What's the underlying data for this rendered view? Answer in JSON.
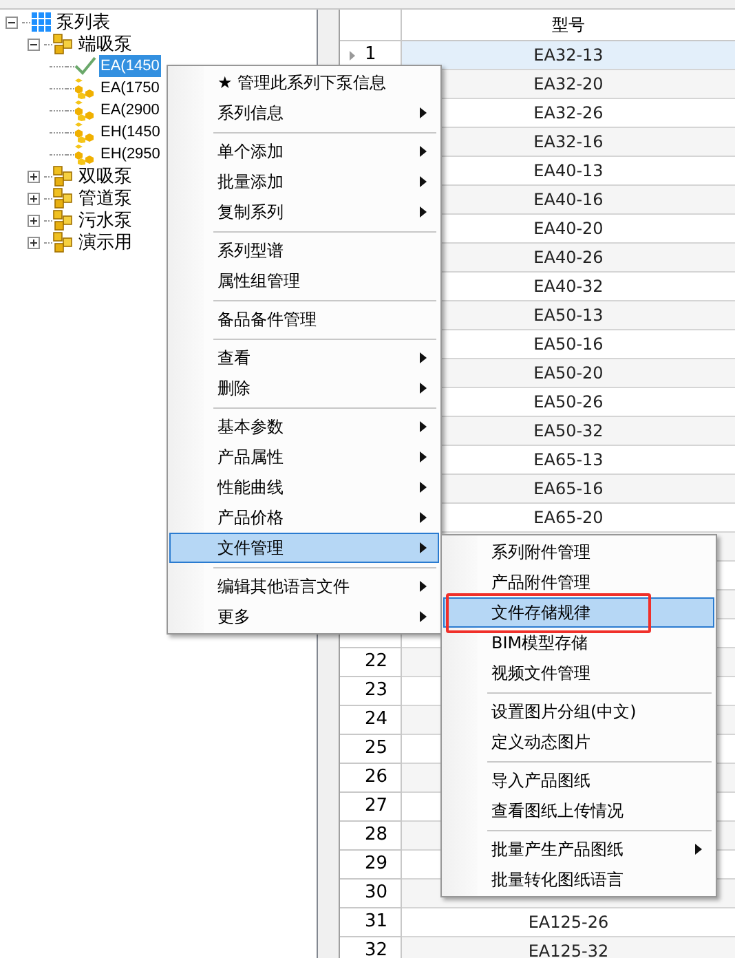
{
  "tree": {
    "label": "泵列表",
    "expanded": true,
    "children": [
      {
        "label": "端吸泵",
        "expanded": true,
        "children": [
          {
            "label": "EA(1450",
            "selected": true
          },
          {
            "label": "EA(1750",
            "selected": false
          },
          {
            "label": "EA(2900",
            "selected": false
          },
          {
            "label": "EH(1450",
            "selected": false
          },
          {
            "label": "EH(2950",
            "selected": false
          }
        ]
      },
      {
        "label": "双吸泵",
        "expanded": false
      },
      {
        "label": "管道泵",
        "expanded": false
      },
      {
        "label": "污水泵",
        "expanded": false
      },
      {
        "label": "演示用",
        "expanded": false
      }
    ]
  },
  "table": {
    "columns": [
      "型号"
    ],
    "rows": [
      {
        "number": "1",
        "model": "EA32-13",
        "selected": true
      },
      {
        "model": "EA32-20",
        "selected": false
      },
      {
        "model": "EA32-26",
        "selected": false
      },
      {
        "model": "EA32-16",
        "selected": false
      },
      {
        "model": "EA40-13",
        "selected": false
      },
      {
        "model": "EA40-16",
        "selected": false
      },
      {
        "model": "EA40-20",
        "selected": false
      },
      {
        "model": "EA40-26",
        "selected": false
      },
      {
        "model": "EA40-32",
        "selected": false
      },
      {
        "model": "EA50-13",
        "selected": false
      },
      {
        "model": "EA50-16",
        "selected": false
      },
      {
        "model": "EA50-20",
        "selected": false
      },
      {
        "model": "EA50-26",
        "selected": false
      },
      {
        "model": "EA50-32",
        "selected": false
      },
      {
        "model": "EA65-13",
        "selected": false
      },
      {
        "model": "EA65-16",
        "selected": false
      },
      {
        "model": "EA65-20",
        "selected": false
      },
      {
        "selected": false
      },
      {
        "selected": false
      },
      {
        "selected": false
      },
      {
        "selected": false
      },
      {
        "number": "22",
        "selected": false
      },
      {
        "number": "23",
        "selected": false
      },
      {
        "number": "24",
        "selected": false
      },
      {
        "number": "25",
        "selected": false
      },
      {
        "number": "26",
        "selected": false
      },
      {
        "number": "27",
        "selected": false
      },
      {
        "number": "28",
        "selected": false
      },
      {
        "number": "29",
        "selected": false
      },
      {
        "number": "30",
        "selected": false
      },
      {
        "number": "31",
        "model": "EA125-26",
        "selected": false
      },
      {
        "number": "32",
        "model": "EA125-32",
        "selected": false
      }
    ]
  },
  "context_menu": [
    {
      "kind": "item",
      "label": "★ 管理此系列下泵信息",
      "submenu": false,
      "selected": false
    },
    {
      "kind": "item",
      "label": "系列信息",
      "submenu": true,
      "selected": false
    },
    {
      "kind": "separator"
    },
    {
      "kind": "item",
      "label": "单个添加",
      "submenu": true,
      "selected": false
    },
    {
      "kind": "item",
      "label": "批量添加",
      "submenu": true,
      "selected": false
    },
    {
      "kind": "item",
      "label": "复制系列",
      "submenu": true,
      "selected": false
    },
    {
      "kind": "separator"
    },
    {
      "kind": "item",
      "label": "系列型谱",
      "submenu": false,
      "selected": false
    },
    {
      "kind": "item",
      "label": "属性组管理",
      "submenu": false,
      "selected": false
    },
    {
      "kind": "separator"
    },
    {
      "kind": "item",
      "label": "备品备件管理",
      "submenu": false,
      "selected": false
    },
    {
      "kind": "separator"
    },
    {
      "kind": "item",
      "label": "查看",
      "submenu": true,
      "selected": false
    },
    {
      "kind": "item",
      "label": "删除",
      "submenu": true,
      "selected": false
    },
    {
      "kind": "separator"
    },
    {
      "kind": "item",
      "label": "基本参数",
      "submenu": true,
      "selected": false
    },
    {
      "kind": "item",
      "label": "产品属性",
      "submenu": true,
      "selected": false
    },
    {
      "kind": "item",
      "label": "性能曲线",
      "submenu": true,
      "selected": false
    },
    {
      "kind": "item",
      "label": "产品价格",
      "submenu": true,
      "selected": false
    },
    {
      "kind": "item",
      "label": "文件管理",
      "submenu": true,
      "selected": true
    },
    {
      "kind": "separator"
    },
    {
      "kind": "item",
      "label": "编辑其他语言文件",
      "submenu": true,
      "selected": false
    },
    {
      "kind": "item",
      "label": "更多",
      "submenu": true,
      "selected": false
    }
  ],
  "submenu": [
    {
      "kind": "item",
      "label": "系列附件管理",
      "submenu": false,
      "selected": false
    },
    {
      "kind": "item",
      "label": "产品附件管理",
      "submenu": false,
      "selected": false
    },
    {
      "kind": "item",
      "label": "文件存储规律",
      "submenu": false,
      "selected": true,
      "marked": true
    },
    {
      "kind": "item",
      "label": "BIM模型存储",
      "submenu": false,
      "selected": false
    },
    {
      "kind": "item",
      "label": "视频文件管理",
      "submenu": false,
      "selected": false
    },
    {
      "kind": "separator"
    },
    {
      "kind": "item",
      "label": "设置图片分组(中文)",
      "submenu": false,
      "selected": false
    },
    {
      "kind": "item",
      "label": "定义动态图片",
      "submenu": false,
      "selected": false
    },
    {
      "kind": "separator"
    },
    {
      "kind": "item",
      "label": "导入产品图纸",
      "submenu": false,
      "selected": false
    },
    {
      "kind": "item",
      "label": "查看图纸上传情况",
      "submenu": false,
      "selected": false
    },
    {
      "kind": "separator"
    },
    {
      "kind": "item",
      "label": "批量产生产品图纸",
      "submenu": true,
      "selected": false
    },
    {
      "kind": "item",
      "label": "批量转化图纸语言",
      "submenu": false,
      "selected": false
    }
  ]
}
